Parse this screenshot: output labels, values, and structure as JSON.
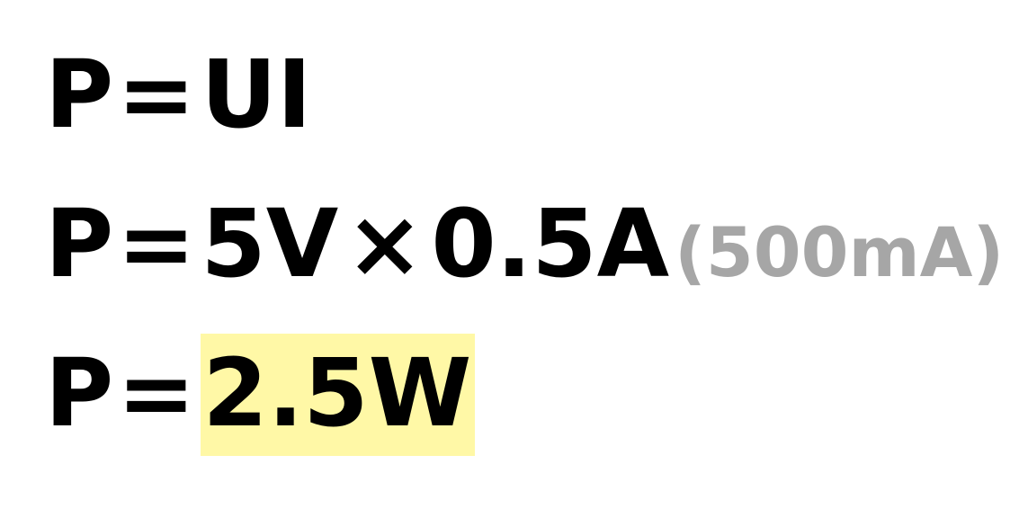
{
  "line1": {
    "lhs": "P",
    "eq": "=",
    "rhs": "UI"
  },
  "line2": {
    "lhs": "P",
    "eq": "=",
    "voltage": "5V",
    "times": "×",
    "current": "0.5A",
    "current_note": "(500mA)"
  },
  "line3": {
    "lhs": "P",
    "eq": "=",
    "result": "2.5W"
  },
  "colors": {
    "text": "#000000",
    "note": "#a6a6a6",
    "highlight": "#fff8a6"
  }
}
